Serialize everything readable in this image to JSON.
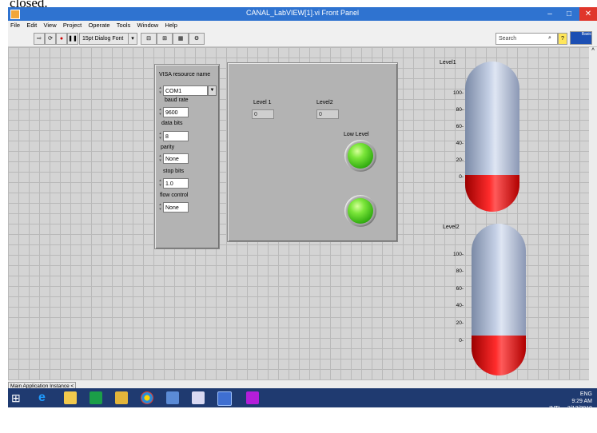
{
  "caption": "closed.",
  "window": {
    "title": "CANAL_LabVIEW[1].vi Front Panel",
    "min": "–",
    "max": "□",
    "close": "✕"
  },
  "menu": [
    "File",
    "Edit",
    "View",
    "Project",
    "Operate",
    "Tools",
    "Window",
    "Help"
  ],
  "toolbar": {
    "font": "15pt Dialog Font",
    "search_placeholder": "Search",
    "help": "?",
    "palette_label": "Basic"
  },
  "serial": {
    "visa_label": "VISA resource name",
    "visa_value": "COM1",
    "baud_label": "baud rate",
    "baud_value": "9600",
    "databits_label": "data bits",
    "databits_value": "8",
    "parity_label": "parity",
    "parity_value": "None",
    "stopbits_label": "stop bits",
    "stopbits_value": "1.0",
    "flow_label": "flow control",
    "flow_value": "None"
  },
  "indicators": {
    "level1_label": "Level 1",
    "level1_value": "0",
    "level2_label": "Level2",
    "level2_value": "0",
    "low_label": "Low Level",
    "led_color": "#4fd11f"
  },
  "tanks": [
    {
      "label": "Level1",
      "ticks": [
        "100-",
        "80-",
        "60-",
        "40-",
        "20-",
        "0-"
      ],
      "level": 0
    },
    {
      "label": "Level2",
      "ticks": [
        "100-",
        "80-",
        "60-",
        "40-",
        "20-",
        "0-"
      ],
      "level": 0
    }
  ],
  "status": {
    "instance": "Main Application Instance",
    "arrow": "<"
  },
  "tray": {
    "lang1": "ENG",
    "lang2": "INTL",
    "time": "9:29 AM",
    "date": "3/13/2019"
  },
  "colors": {
    "titlebar": "#2f73d0",
    "tank_fill": "#ff2c2c",
    "taskbar": "#1f3a70"
  }
}
